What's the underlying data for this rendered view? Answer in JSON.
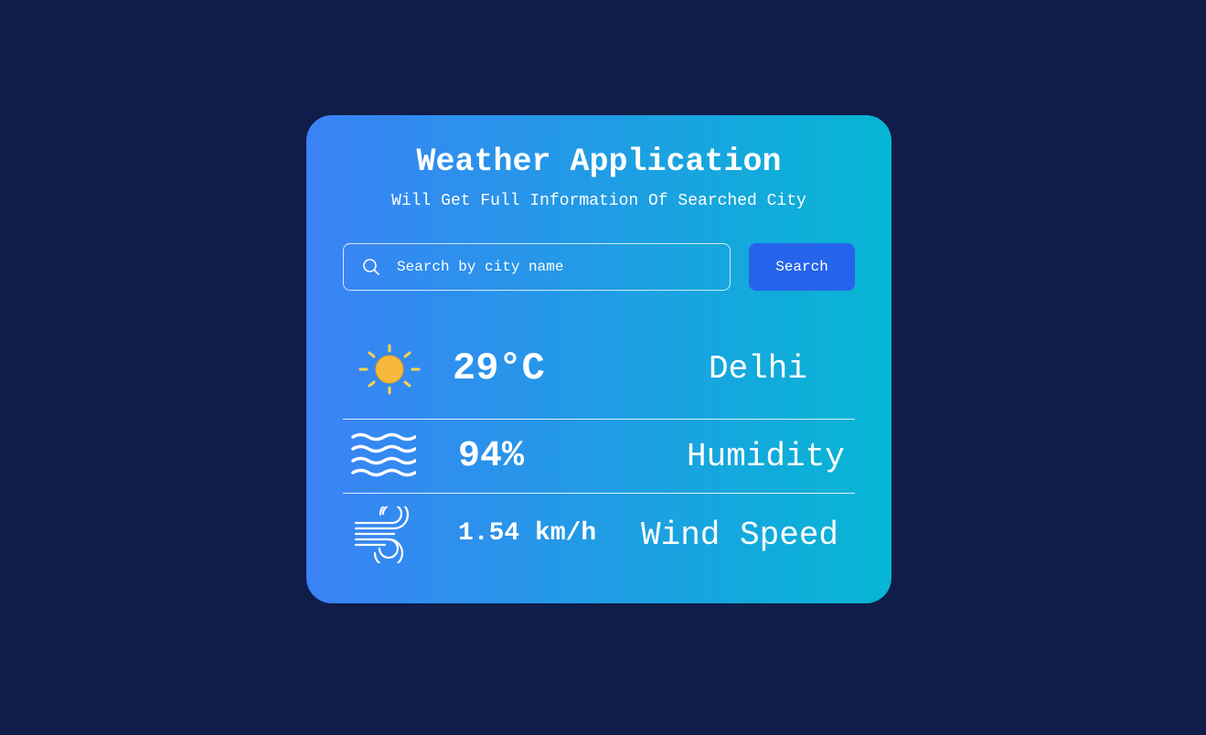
{
  "header": {
    "title": "Weather Application",
    "subtitle": "Will Get Full Information Of Searched City"
  },
  "search": {
    "placeholder": "Search by city name",
    "value": "",
    "button_label": "Search",
    "icon": "search-icon"
  },
  "weather": {
    "icon": "sun-icon",
    "temperature": "29°C",
    "city": "Delhi"
  },
  "humidity": {
    "icon": "waves-icon",
    "value": "94%",
    "label": "Humidity"
  },
  "wind": {
    "icon": "wind-icon",
    "value": "1.54 km/h",
    "label": "Wind Speed"
  },
  "colors": {
    "background": "#0f1d48",
    "card_gradient_start": "#3b82f6",
    "card_gradient_end": "#06b6d4",
    "button": "#2563eb",
    "sun": "#f6b93b",
    "sun_rays": "#fcd34d"
  }
}
